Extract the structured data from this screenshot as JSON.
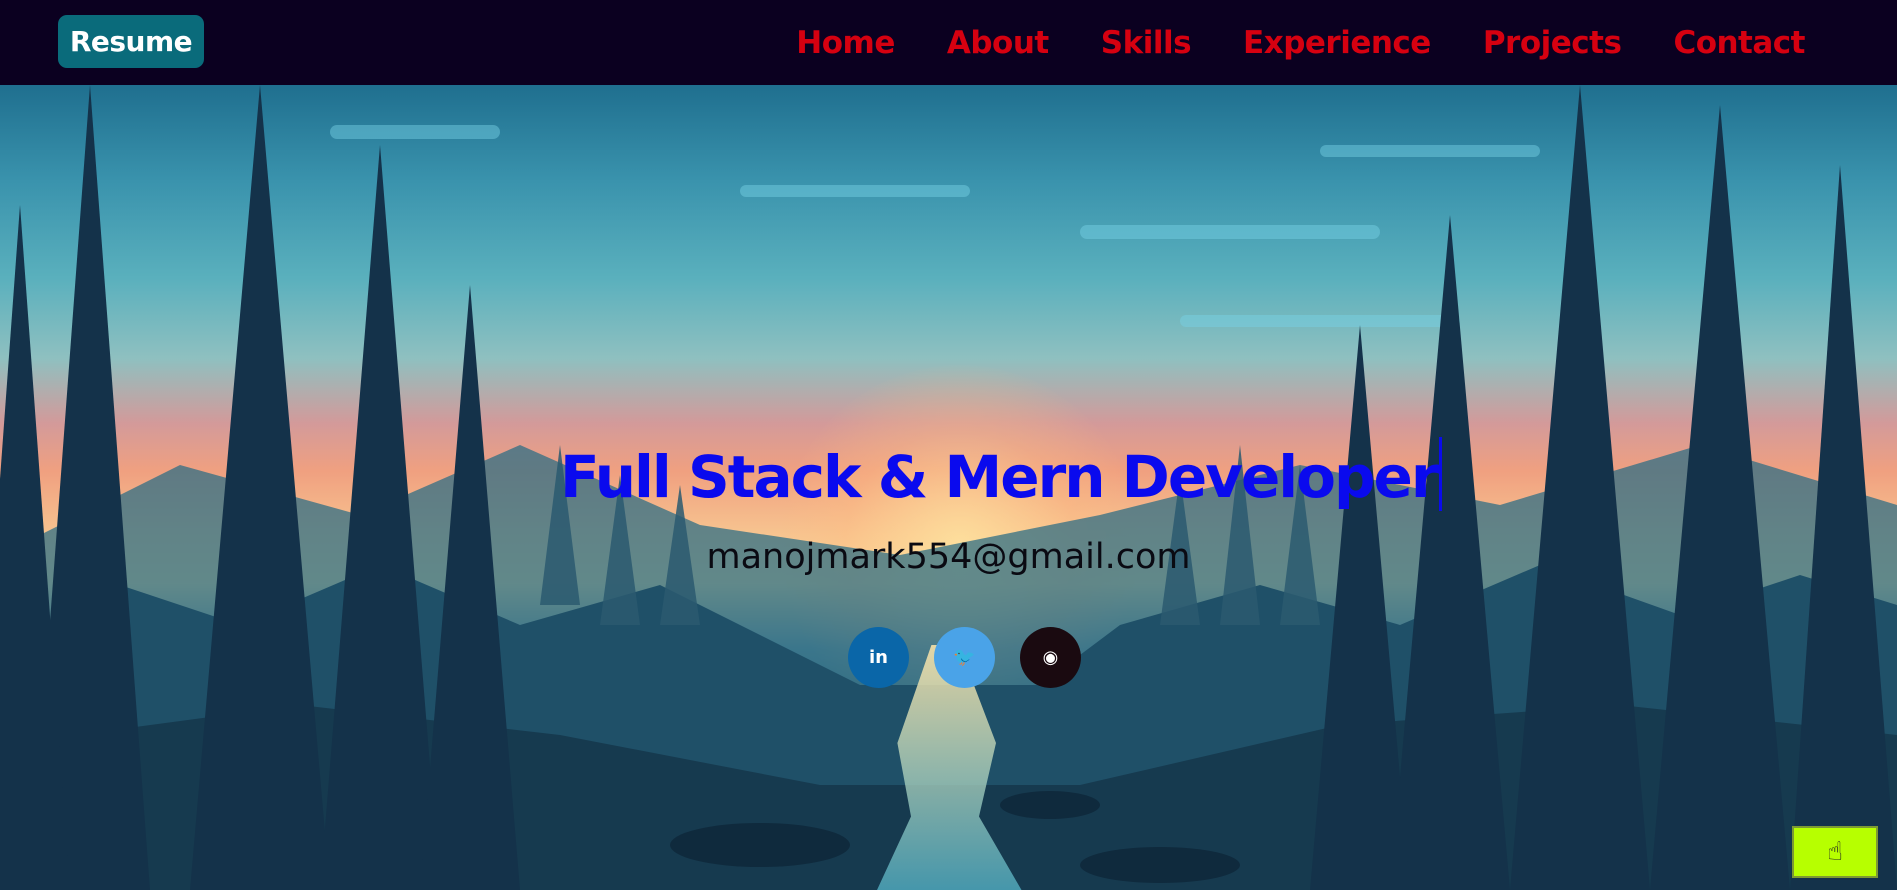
{
  "navbar": {
    "brand": "Resume",
    "links": [
      "Home",
      "About",
      "Skills",
      "Experience",
      "Projects",
      "Contact"
    ]
  },
  "hero": {
    "headline": "Full Stack & Mern Developer",
    "email": "manojmark554@gmail.com",
    "socials": [
      {
        "icon": "linkedin-icon",
        "glyph": "in",
        "color": "#0a66a8"
      },
      {
        "icon": "twitter-icon",
        "glyph": "🐦",
        "color": "#4aa3e8"
      },
      {
        "icon": "github-icon",
        "glyph": "◉",
        "color": "#1a0a10"
      }
    ]
  },
  "floating_button": {
    "icon": "pointing-hand-icon",
    "glyph": "☝",
    "color": "#b7ff00"
  },
  "colors": {
    "nav_background": "#0b0020",
    "nav_link": "#d60010",
    "brand_background": "#0a6b7b",
    "headline": "#0a0aee"
  }
}
